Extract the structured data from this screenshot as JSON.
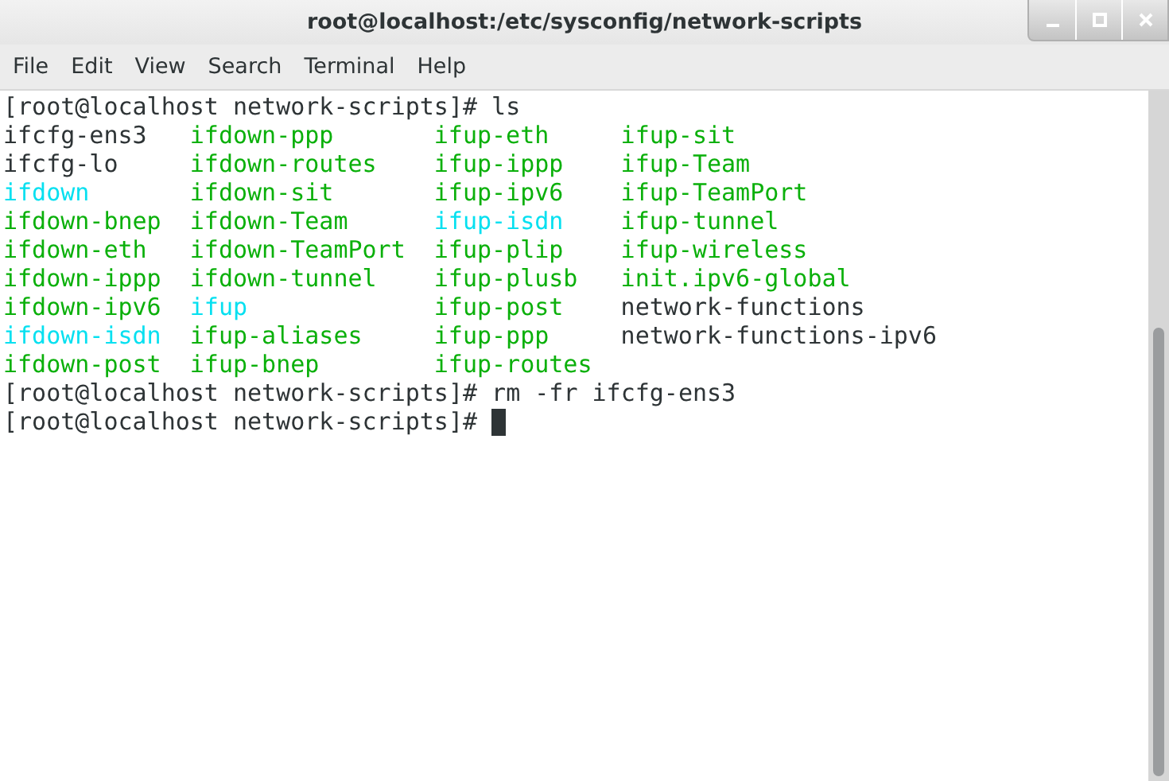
{
  "window": {
    "title": "root@localhost:/etc/sysconfig/network-scripts"
  },
  "menu": [
    "File",
    "Edit",
    "View",
    "Search",
    "Terminal",
    "Help"
  ],
  "terminal": {
    "lines": [
      {
        "kind": "prompt",
        "text": "[root@localhost network-scripts]# ls",
        "cursor": false
      },
      {
        "kind": "listing",
        "files": [
          {
            "name": "ifcfg-ens3",
            "kind": "regular"
          },
          {
            "name": "ifcfg-lo",
            "kind": "regular"
          },
          {
            "name": "ifdown",
            "kind": "symlink"
          },
          {
            "name": "ifdown-bnep",
            "kind": "executable"
          },
          {
            "name": "ifdown-eth",
            "kind": "executable"
          },
          {
            "name": "ifdown-ippp",
            "kind": "executable"
          },
          {
            "name": "ifdown-ipv6",
            "kind": "executable"
          },
          {
            "name": "ifdown-isdn",
            "kind": "symlink"
          },
          {
            "name": "ifdown-post",
            "kind": "executable"
          },
          {
            "name": "ifdown-ppp",
            "kind": "executable"
          },
          {
            "name": "ifdown-routes",
            "kind": "executable"
          },
          {
            "name": "ifdown-sit",
            "kind": "executable"
          },
          {
            "name": "ifdown-Team",
            "kind": "executable"
          },
          {
            "name": "ifdown-TeamPort",
            "kind": "executable"
          },
          {
            "name": "ifdown-tunnel",
            "kind": "executable"
          },
          {
            "name": "ifup",
            "kind": "symlink"
          },
          {
            "name": "ifup-aliases",
            "kind": "executable"
          },
          {
            "name": "ifup-bnep",
            "kind": "executable"
          },
          {
            "name": "ifup-eth",
            "kind": "executable"
          },
          {
            "name": "ifup-ippp",
            "kind": "executable"
          },
          {
            "name": "ifup-ipv6",
            "kind": "executable"
          },
          {
            "name": "ifup-isdn",
            "kind": "symlink"
          },
          {
            "name": "ifup-plip",
            "kind": "executable"
          },
          {
            "name": "ifup-plusb",
            "kind": "executable"
          },
          {
            "name": "ifup-post",
            "kind": "executable"
          },
          {
            "name": "ifup-ppp",
            "kind": "executable"
          },
          {
            "name": "ifup-routes",
            "kind": "executable"
          },
          {
            "name": "ifup-sit",
            "kind": "executable"
          },
          {
            "name": "ifup-Team",
            "kind": "executable"
          },
          {
            "name": "ifup-TeamPort",
            "kind": "executable"
          },
          {
            "name": "ifup-tunnel",
            "kind": "executable"
          },
          {
            "name": "ifup-wireless",
            "kind": "executable"
          },
          {
            "name": "init.ipv6-global",
            "kind": "executable"
          },
          {
            "name": "network-functions",
            "kind": "regular"
          },
          {
            "name": "network-functions-ipv6",
            "kind": "regular"
          }
        ]
      },
      {
        "kind": "prompt",
        "text": "[root@localhost network-scripts]# rm -fr ifcfg-ens3",
        "cursor": false
      },
      {
        "kind": "prompt",
        "text": "[root@localhost network-scripts]#",
        "cursor": true
      }
    ]
  }
}
